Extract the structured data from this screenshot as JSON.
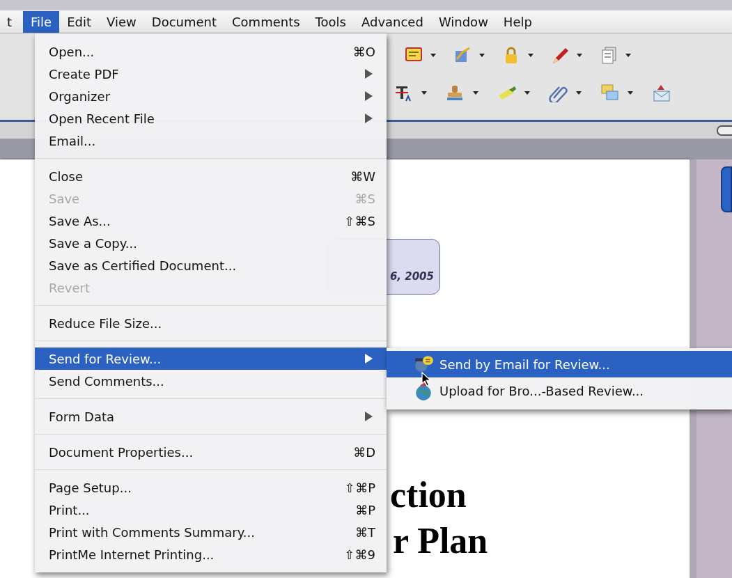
{
  "menubar": {
    "items": [
      {
        "label": "t",
        "selected": false
      },
      {
        "label": "File",
        "selected": true
      },
      {
        "label": "Edit",
        "selected": false
      },
      {
        "label": "View",
        "selected": false
      },
      {
        "label": "Document",
        "selected": false
      },
      {
        "label": "Comments",
        "selected": false
      },
      {
        "label": "Tools",
        "selected": false
      },
      {
        "label": "Advanced",
        "selected": false
      },
      {
        "label": "Window",
        "selected": false
      },
      {
        "label": "Help",
        "selected": false
      }
    ]
  },
  "file_menu": {
    "items": [
      {
        "kind": "item",
        "label": "Open...",
        "shortcut": "⌘O",
        "submenu": false,
        "disabled": false,
        "selected": false
      },
      {
        "kind": "item",
        "label": "Create PDF",
        "submenu": true,
        "disabled": false,
        "selected": false
      },
      {
        "kind": "item",
        "label": "Organizer",
        "submenu": true,
        "disabled": false,
        "selected": false
      },
      {
        "kind": "item",
        "label": "Open Recent File",
        "submenu": true,
        "disabled": false,
        "selected": false
      },
      {
        "kind": "item",
        "label": "Email...",
        "submenu": false,
        "disabled": false,
        "selected": false
      },
      {
        "kind": "separator"
      },
      {
        "kind": "item",
        "label": "Close",
        "shortcut": "⌘W",
        "submenu": false,
        "disabled": false,
        "selected": false
      },
      {
        "kind": "item",
        "label": "Save",
        "shortcut": "⌘S",
        "submenu": false,
        "disabled": true,
        "selected": false
      },
      {
        "kind": "item",
        "label": "Save As...",
        "shortcut": "⇧⌘S",
        "submenu": false,
        "disabled": false,
        "selected": false
      },
      {
        "kind": "item",
        "label": "Save a Copy...",
        "submenu": false,
        "disabled": false,
        "selected": false
      },
      {
        "kind": "item",
        "label": "Save as Certified Document...",
        "submenu": false,
        "disabled": false,
        "selected": false
      },
      {
        "kind": "item",
        "label": "Revert",
        "submenu": false,
        "disabled": true,
        "selected": false
      },
      {
        "kind": "separator"
      },
      {
        "kind": "item",
        "label": "Reduce File Size...",
        "submenu": false,
        "disabled": false,
        "selected": false
      },
      {
        "kind": "separator"
      },
      {
        "kind": "item",
        "label": "Send for Review...",
        "submenu": true,
        "disabled": false,
        "selected": true
      },
      {
        "kind": "item",
        "label": "Send Comments...",
        "submenu": false,
        "disabled": false,
        "selected": false
      },
      {
        "kind": "separator"
      },
      {
        "kind": "item",
        "label": "Form Data",
        "submenu": true,
        "disabled": false,
        "selected": false
      },
      {
        "kind": "separator"
      },
      {
        "kind": "item",
        "label": "Document Properties...",
        "shortcut": "⌘D",
        "submenu": false,
        "disabled": false,
        "selected": false
      },
      {
        "kind": "separator"
      },
      {
        "kind": "item",
        "label": "Page Setup...",
        "shortcut": "⇧⌘P",
        "submenu": false,
        "disabled": false,
        "selected": false
      },
      {
        "kind": "item",
        "label": "Print...",
        "shortcut": "⌘P",
        "submenu": false,
        "disabled": false,
        "selected": false
      },
      {
        "kind": "item",
        "label": "Print with Comments Summary...",
        "shortcut": "⌘T",
        "submenu": false,
        "disabled": false,
        "selected": false
      },
      {
        "kind": "item",
        "label": "PrintMe Internet Printing...",
        "shortcut": "⇧⌘9",
        "submenu": false,
        "disabled": false,
        "selected": false
      }
    ]
  },
  "review_submenu": {
    "items": [
      {
        "kind": "email",
        "label": "Send by Email for Review...",
        "selected": true
      },
      {
        "kind": "upload",
        "label": "Upload for Bro...-Based Review...",
        "selected": false
      }
    ]
  },
  "document": {
    "date": "6, 2005",
    "title_lines": [
      "ction",
      "r Plan"
    ]
  }
}
